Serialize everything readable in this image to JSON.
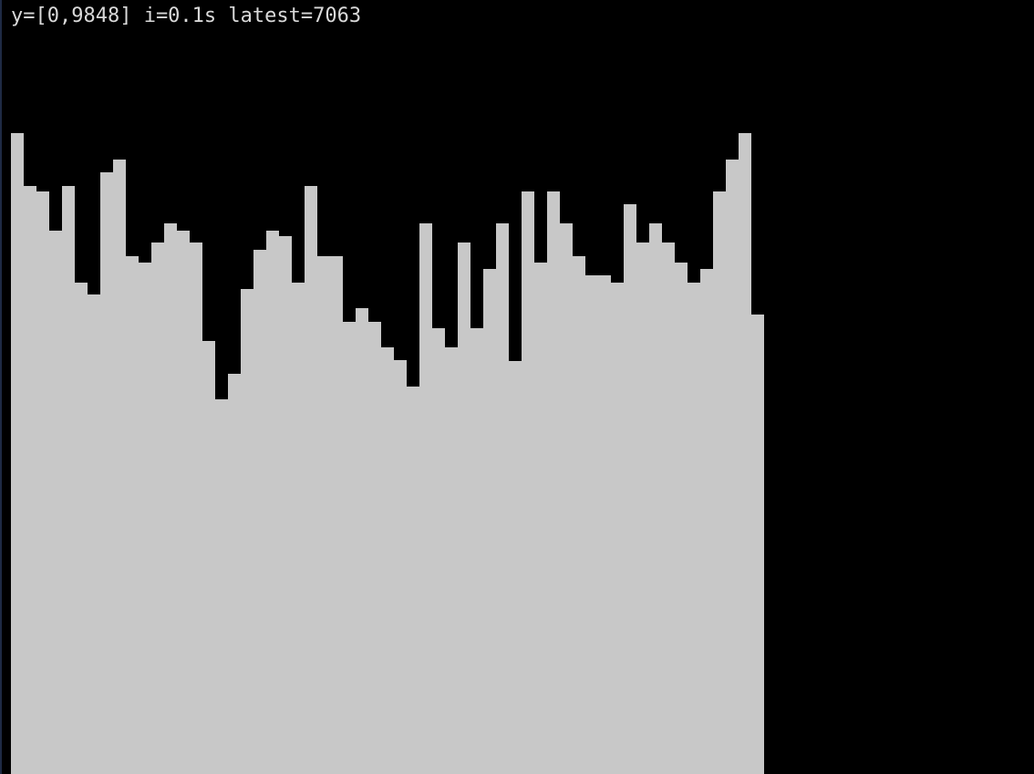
{
  "terminal": {
    "status_line": "y=[0,9848] i=0.1s latest=7063",
    "background_color": "#000000",
    "text_color": "#d9d9d9"
  },
  "chart_data": {
    "type": "bar",
    "ylim": [
      0,
      9848
    ],
    "bar_color": "#c8c8c8",
    "interval_seconds": 0.1,
    "latest": 7063,
    "values": [
      9848,
      9042,
      8950,
      8350,
      9042,
      7554,
      7363,
      9243,
      9442,
      7963,
      7862,
      8160,
      8460,
      8350,
      8160,
      6655,
      5756,
      6156,
      7454,
      8060,
      8350,
      8259,
      7554,
      9042,
      7963,
      7963,
      6954,
      7162,
      6954,
      6560,
      6353,
      5955,
      8460,
      6852,
      6560,
      8160,
      6852,
      7755,
      8460,
      6351,
      8950,
      7862,
      8950,
      8460,
      7963,
      7663,
      7663,
      7554,
      8759,
      8160,
      8460,
      8160,
      7862,
      7554,
      7763,
      8950,
      9442,
      9848,
      7063
    ]
  }
}
